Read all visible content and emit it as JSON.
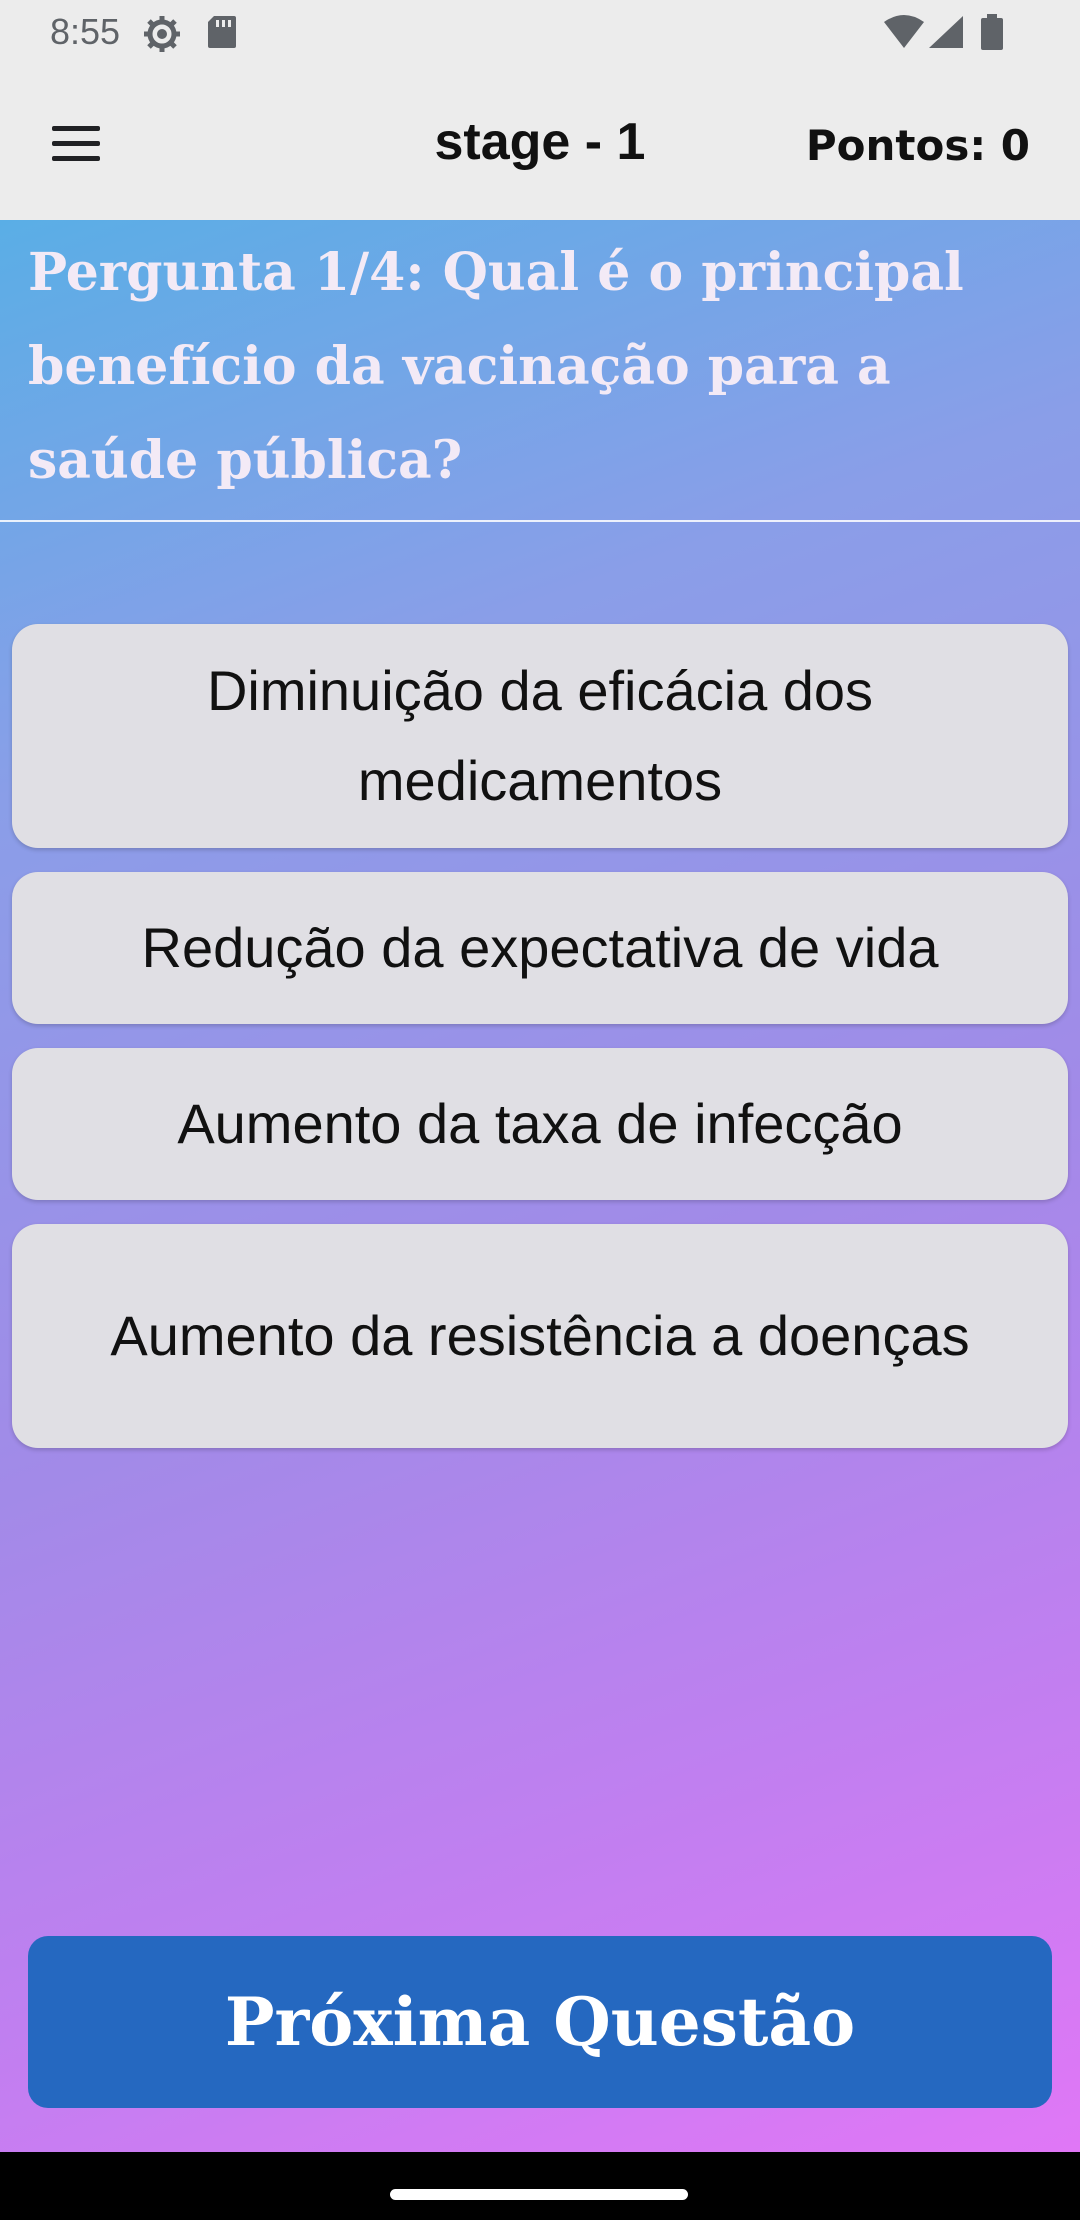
{
  "status_bar": {
    "time": "8:55",
    "icons": [
      "settings-gear-icon",
      "sd-card-icon",
      "wifi-icon",
      "cell-signal-icon",
      "battery-icon"
    ]
  },
  "app_bar": {
    "menu_icon": "hamburger-menu-icon",
    "title": "stage - 1",
    "score": "Pontos: 0"
  },
  "quiz": {
    "question": "Pergunta 1/4: Qual é o principal benefício da vacinação para a saúde pública?",
    "answers": [
      "Diminuição da eficácia dos medicamentos",
      "Redução da expectativa de vida",
      "Aumento da taxa de infecção",
      "Aumento da resistência a doenças"
    ],
    "next_label": "Próxima Questão"
  },
  "colors": {
    "gradient_top": "#5aaee6",
    "gradient_bottom": "#e077f6",
    "answer_bg": "#e0dfe4",
    "next_button": "#2568c0"
  }
}
